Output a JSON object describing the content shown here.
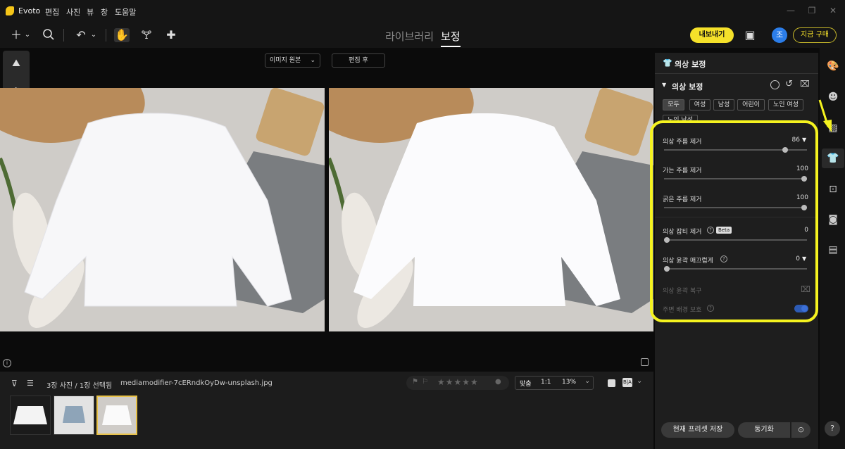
{
  "app": {
    "title": "Evoto",
    "menu": [
      "편집",
      "사진",
      "뷰",
      "창",
      "도움말"
    ]
  },
  "toolbar": {
    "tab_library": "라이브러리",
    "tab_edit": "보정",
    "export_label": "내보내기",
    "avatar_initial": "조",
    "buy_label": "지금 구매"
  },
  "canvas": {
    "original_label": "이미지 원본",
    "after_label": "편집 후"
  },
  "filmstrip": {
    "status": "3장 사진 / 1장 선택됨",
    "filename": "mediamodifier-7cERndkOyDw-unsplash.jpg",
    "fit_label": "맞춤",
    "ratio_label": "1:1",
    "zoom": "13%",
    "rating_stars": 5
  },
  "panel": {
    "header": "의상 보정",
    "section_title": "의상 보정",
    "chips": [
      "모두",
      "여성",
      "남성",
      "어린이",
      "노인 여성",
      "노인 남성"
    ],
    "sliders": [
      {
        "label": "의상 주름 제거",
        "value": "86",
        "level": 0.86
      },
      {
        "label": "가는 주름 제거",
        "value": "100",
        "level": 1.0
      },
      {
        "label": "굵은 주름 제거",
        "value": "100",
        "level": 1.0
      },
      {
        "label": "의상 잡티 제거",
        "value": "0",
        "level": 0.0,
        "badge": "Beta"
      },
      {
        "label": "의상 윤곽 매끄럽게",
        "value": "0",
        "level": 0.0
      }
    ],
    "restore_label": "의상 윤곽 복구",
    "protect_label": "주변 배경 보호",
    "save_preset_label": "현재 프리셋 저장",
    "sync_label": "동기화"
  },
  "colors": {
    "accent": "#f5e12a",
    "highlight": "#f5f31f",
    "avatar": "#2b7de9",
    "toggle": "#2d5bb5"
  }
}
